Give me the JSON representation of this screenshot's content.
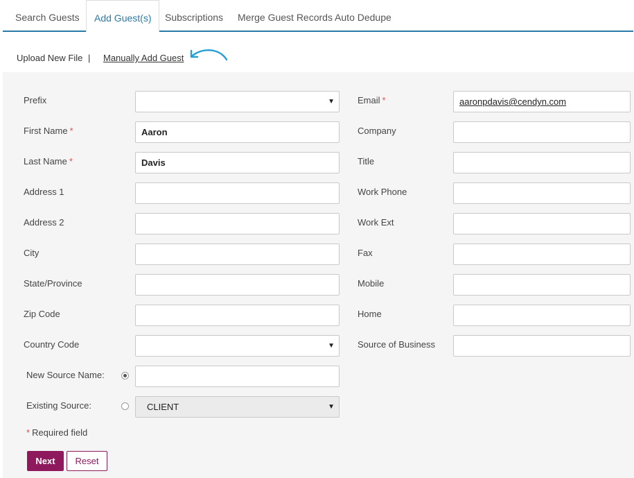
{
  "tabs": [
    {
      "label": "Search Guests"
    },
    {
      "label": "Add Guest(s)"
    },
    {
      "label": "Subscriptions"
    },
    {
      "label": "Merge Guest Records Auto Dedupe"
    }
  ],
  "subnav": {
    "upload": "Upload New File",
    "separator": "|",
    "manual": "Manually Add Guest"
  },
  "form": {
    "prefix_label": "Prefix",
    "prefix_value": "",
    "first_name_label": "First Name",
    "first_name_value": "Aaron",
    "last_name_label": "Last Name",
    "last_name_value": "Davis",
    "address1_label": "Address 1",
    "address2_label": "Address 2",
    "city_label": "City",
    "state_label": "State/Province",
    "zip_label": "Zip Code",
    "country_label": "Country Code",
    "new_source_label": "New Source Name:",
    "existing_source_label": "Existing Source:",
    "existing_source_value": "CLIENT",
    "email_label": "Email",
    "email_value": "aaronpdavis@cendyn.com",
    "company_label": "Company",
    "title_label": "Title",
    "work_phone_label": "Work Phone",
    "work_ext_label": "Work Ext",
    "fax_label": "Fax",
    "mobile_label": "Mobile",
    "home_label": "Home",
    "source_business_label": "Source of Business",
    "required_marker": "*",
    "required_note": "Required field"
  },
  "buttons": {
    "next": "Next",
    "reset": "Reset"
  },
  "colors": {
    "accent": "#2a7aa8",
    "brand": "#8e1a5d",
    "required": "#d9534f"
  }
}
